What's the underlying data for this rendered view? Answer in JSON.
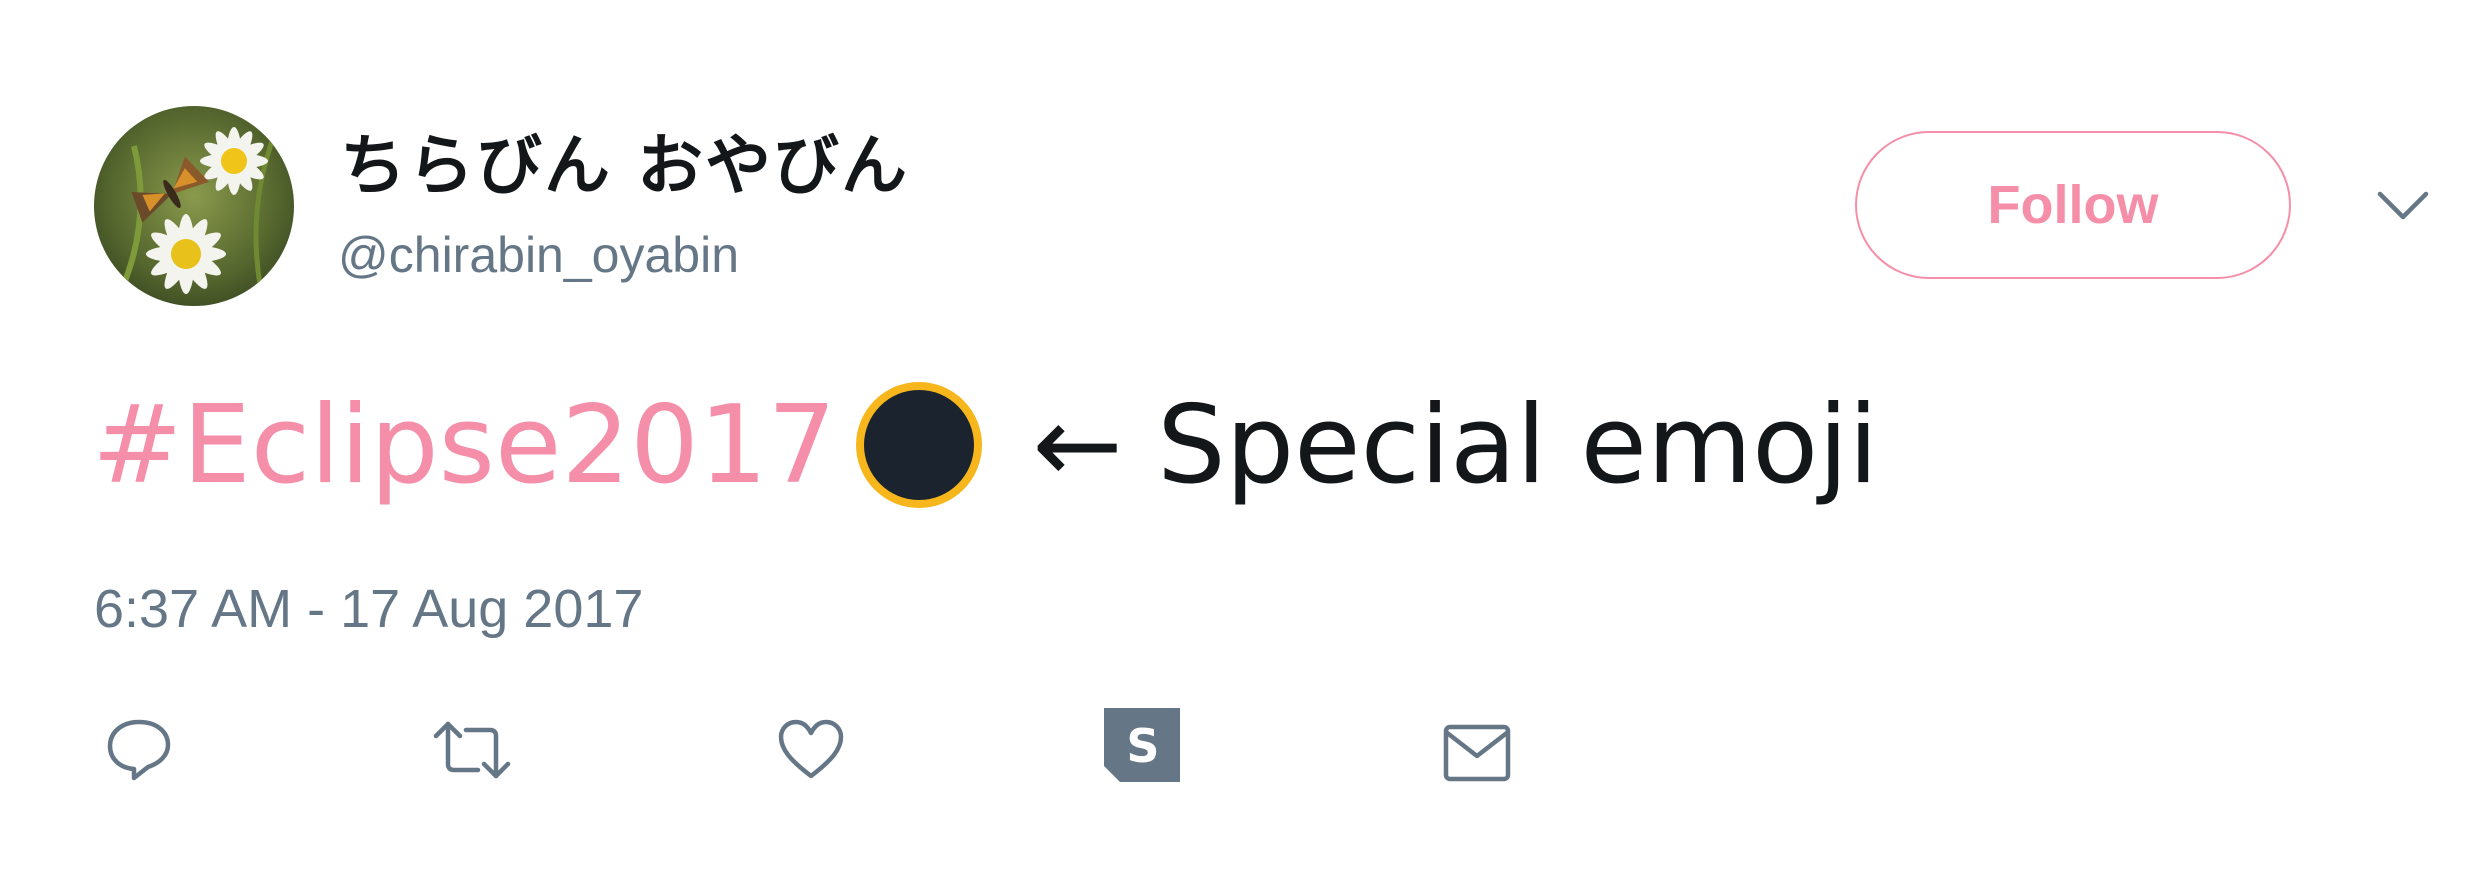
{
  "user": {
    "display_name": "ちらびん おやびん",
    "handle": "@chirabin_oyabin"
  },
  "follow_button": {
    "label": "Follow"
  },
  "tweet": {
    "hashtag": "#Eclipse2017",
    "emoji_icon": "new-moon-eclipse-icon",
    "text": "← Special emoji",
    "timestamp": "6:37 AM - 17 Aug 2017"
  },
  "actions": [
    {
      "icon": "reply-icon"
    },
    {
      "icon": "retweet-icon"
    },
    {
      "icon": "like-icon"
    },
    {
      "icon": "s-bookmark-icon"
    },
    {
      "icon": "mail-icon"
    }
  ],
  "colors": {
    "accent": "#f58ea8",
    "text": "#14171a",
    "muted": "#657786",
    "emoji_fill": "#1a232e",
    "emoji_ring": "#f6b61c"
  }
}
